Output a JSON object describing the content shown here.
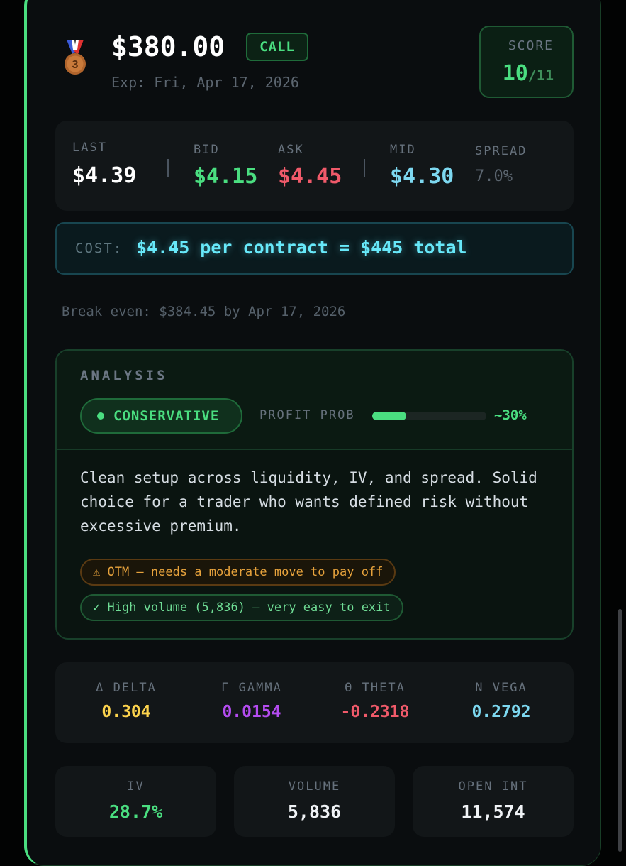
{
  "header": {
    "medal_icon": "third-place-medal-icon",
    "medal_number": "3",
    "strike": "$380.00",
    "option_type": "CALL",
    "expiration": "Exp: Fri, Apr 17, 2026",
    "score_label": "SCORE",
    "score_value": "10",
    "score_max": "/11"
  },
  "quote": {
    "last_label": "LAST",
    "last_value": "$4.39",
    "bid_label": "BID",
    "bid_value": "$4.15",
    "ask_label": "ASK",
    "ask_value": "$4.45",
    "mid_label": "MID",
    "mid_value": "$4.30",
    "spread_label": "SPREAD",
    "spread_value": "7.0%"
  },
  "cost": {
    "label": "COST:",
    "value": "$4.45 per contract = $445 total"
  },
  "break_even": "Break even: $384.45 by Apr 17, 2026",
  "analysis": {
    "title": "ANALYSIS",
    "strategy": "CONSERVATIVE",
    "profit_prob_label": "PROFIT PROB",
    "profit_prob_fraction": 0.3,
    "profit_prob_value": "~30%",
    "description": "Clean setup across liquidity, IV, and spread. Solid choice for a trader who wants defined risk without excessive premium.",
    "warning_icon": "warning-icon",
    "warning_text": "⚠ OTM — needs a moderate move to pay off",
    "ok_icon": "check-icon",
    "ok_text": "✓ High volume (5,836) — very easy to exit"
  },
  "greeks": [
    {
      "label": "Δ DELTA",
      "value": "0.304",
      "color": "#fcd34d"
    },
    {
      "label": "Γ GAMMA",
      "value": "0.0154",
      "color": "#b44cf0"
    },
    {
      "label": "Θ THETA",
      "value": "-0.2318",
      "color": "#f05a6a"
    },
    {
      "label": "N VEGA",
      "value": "0.2792",
      "color": "#7dd8f0"
    }
  ],
  "stats": [
    {
      "label": "IV",
      "value": "28.7%",
      "color": "#4ade80"
    },
    {
      "label": "VOLUME",
      "value": "5,836",
      "color": "#f0f3f6"
    },
    {
      "label": "OPEN INT",
      "value": "11,574",
      "color": "#f0f3f6"
    }
  ],
  "colors": {
    "accent": "#4ade80",
    "bid": "#4ade80",
    "ask": "#f05a6a",
    "mid": "#7dd8f0",
    "cost": "#67e8f9",
    "warning": "#e6a23c"
  }
}
